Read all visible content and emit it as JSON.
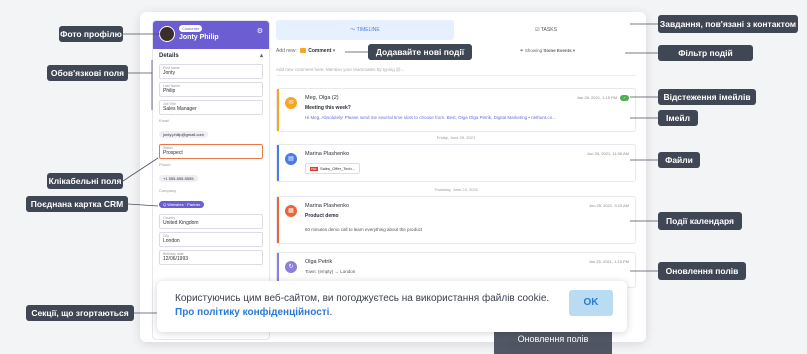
{
  "profile": {
    "badge": "Customer",
    "name": "Jonty Philip",
    "details_title": "Details",
    "fields": [
      {
        "label": "First name",
        "value": "Jonty"
      },
      {
        "label": "Last Name",
        "value": "Philip"
      },
      {
        "label": "Job Title",
        "value": "Sales Manager"
      }
    ],
    "email_label": "Email",
    "email_value": "jonty.philip@gmail.com",
    "status_label": "Status",
    "status_value": "Prospect",
    "phone_label": "Phone",
    "phone_value": "+1 555-555-5555",
    "company_label": "Company",
    "company_value": "Q Websites",
    "company_tag": "Partner",
    "fields2": [
      {
        "label": "Country",
        "value": "United Kingdom"
      },
      {
        "label": "City",
        "value": "London"
      },
      {
        "label": "Birthday date",
        "value": "12/06/1993"
      }
    ]
  },
  "timeline": {
    "tab_timeline": "TIMELINE",
    "tab_tasks": "TASKS",
    "add_new": "Add new:",
    "comment": "Comment",
    "filter_label": "Showing",
    "filter_value": "Some Events",
    "new_comment_placeholder": "Add new comment here. Mention your teammates by typing @...",
    "events": [
      {
        "who": "Meg, Olga (2)",
        "when": "Jun 28, 2021, 1:15 PM",
        "subject": "Meeting this week?",
        "body": "Hi Meg, Absolutely! Please send me several time slots to choose from. Best, Olga Olga Petrik, Digital Marketing • nethunt.co..."
      },
      {
        "who": "Marina Plashenko",
        "when": "Jun 25, 2021, 11:06 AM",
        "file": "Sales_Offer_Tech..."
      },
      {
        "who": "Marina Plashenko",
        "when": "Jun 25, 2021, 9:23 AM",
        "subject": "Product demo",
        "body": "60 minutes demo call to learn everything about the product"
      },
      {
        "who": "Olga Petrik",
        "when": "Jun 25, 2021, 1:15 PM",
        "update": "Town: (empty) → London"
      }
    ],
    "day1": "Friday, June 25, 2021",
    "day2": "Thursday, June 24, 2021"
  },
  "cookie": {
    "message": "Користуючись цим веб-сайтом, ви погоджуєтесь на використання файлів cookie.",
    "link": "Про політику конфіденційності",
    "period": ".",
    "ok": "OK"
  },
  "ghost_label": "Оновлення полів",
  "callouts": {
    "profile_photo": "Фото профілю",
    "required_fields": "Обов'язкові поля",
    "clickable_fields": "Клікабельні поля",
    "linked_crm": "Поєднана картка CRM",
    "collapsible": "Секції, що згортаються",
    "add_events": "Додавайте нові події",
    "tasks": "Завдання, пов'язані з контактом",
    "filter": "Фільтр подій",
    "email_tracking": "Відстеження імейлів",
    "email": "Імейл",
    "files": "Файли",
    "calendar": "Події календаря",
    "field_updates": "Оновлення полів"
  }
}
